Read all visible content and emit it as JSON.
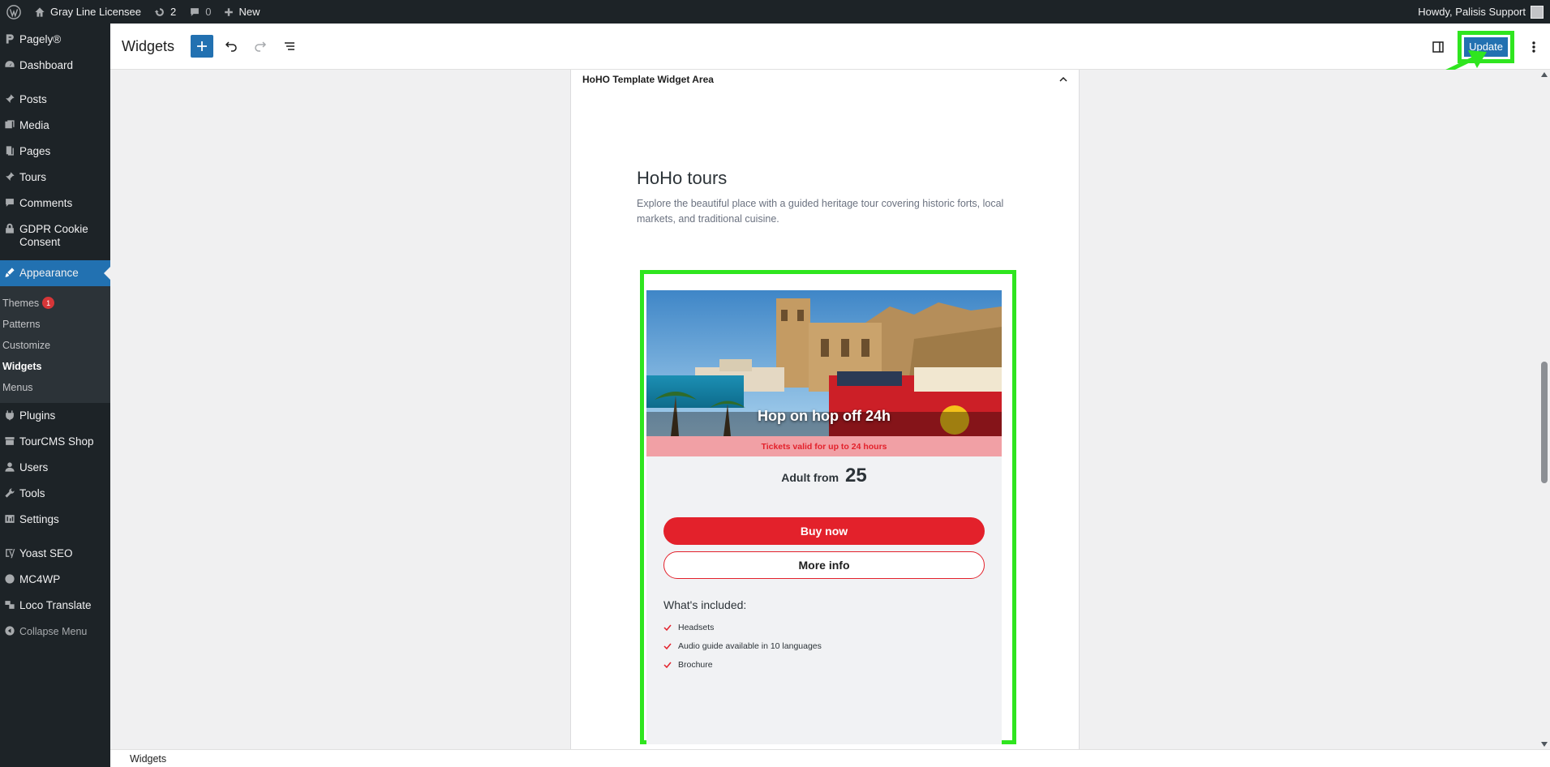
{
  "admin_bar": {
    "site_name": "Gray Line Licensee",
    "updates_count": "2",
    "comments_count": "0",
    "new_label": "New",
    "greeting": "Howdy, Palisis Support"
  },
  "sidebar": {
    "items_top": [
      {
        "label": "Pagely®",
        "icon": "pagely-icon"
      },
      {
        "label": "Dashboard",
        "icon": "dashboard-icon"
      },
      {
        "label": "Posts",
        "icon": "pin-icon"
      },
      {
        "label": "Media",
        "icon": "media-icon"
      },
      {
        "label": "Pages",
        "icon": "pages-icon"
      },
      {
        "label": "Tours",
        "icon": "pin-icon"
      },
      {
        "label": "Comments",
        "icon": "comment-icon"
      },
      {
        "label": "GDPR Cookie Consent",
        "icon": "lock-icon"
      }
    ],
    "appearance_label": "Appearance",
    "submenu": [
      {
        "label": "Themes",
        "badge": "1"
      },
      {
        "label": "Patterns"
      },
      {
        "label": "Customize"
      },
      {
        "label": "Widgets",
        "active": true
      },
      {
        "label": "Menus"
      }
    ],
    "items_bottom": [
      {
        "label": "Plugins",
        "icon": "plugin-icon"
      },
      {
        "label": "TourCMS Shop",
        "icon": "shop-icon"
      },
      {
        "label": "Users",
        "icon": "user-icon"
      },
      {
        "label": "Tools",
        "icon": "wrench-icon"
      },
      {
        "label": "Settings",
        "icon": "settings-icon"
      },
      {
        "label": "Yoast SEO",
        "icon": "yoast-icon"
      },
      {
        "label": "MC4WP",
        "icon": "mail-icon"
      },
      {
        "label": "Loco Translate",
        "icon": "translate-icon"
      }
    ],
    "collapse_label": "Collapse Menu"
  },
  "editor": {
    "title": "Widgets",
    "update_label": "Update"
  },
  "widget_area": {
    "title": "HoHO Template Widget Area",
    "heading": "HoHo tours",
    "description": "Explore the beautiful place with a guided heritage tour covering historic forts, local markets, and traditional cuisine."
  },
  "card": {
    "image_title": "Hop on hop off 24h",
    "validity": "Tickets valid for up to 24 hours",
    "price_label": "Adult from",
    "price_value": "25",
    "buy_label": "Buy now",
    "more_label": "More info",
    "included_title": "What's included:",
    "included_items": [
      "Headsets",
      "Audio guide available in 10 languages",
      "Brochure"
    ]
  },
  "footer": {
    "breadcrumb": "Widgets"
  },
  "colors": {
    "admin_dark": "#1d2327",
    "admin_blue": "#2271b1",
    "tour_red": "#e3212b",
    "highlight_green": "#2fe51f"
  }
}
